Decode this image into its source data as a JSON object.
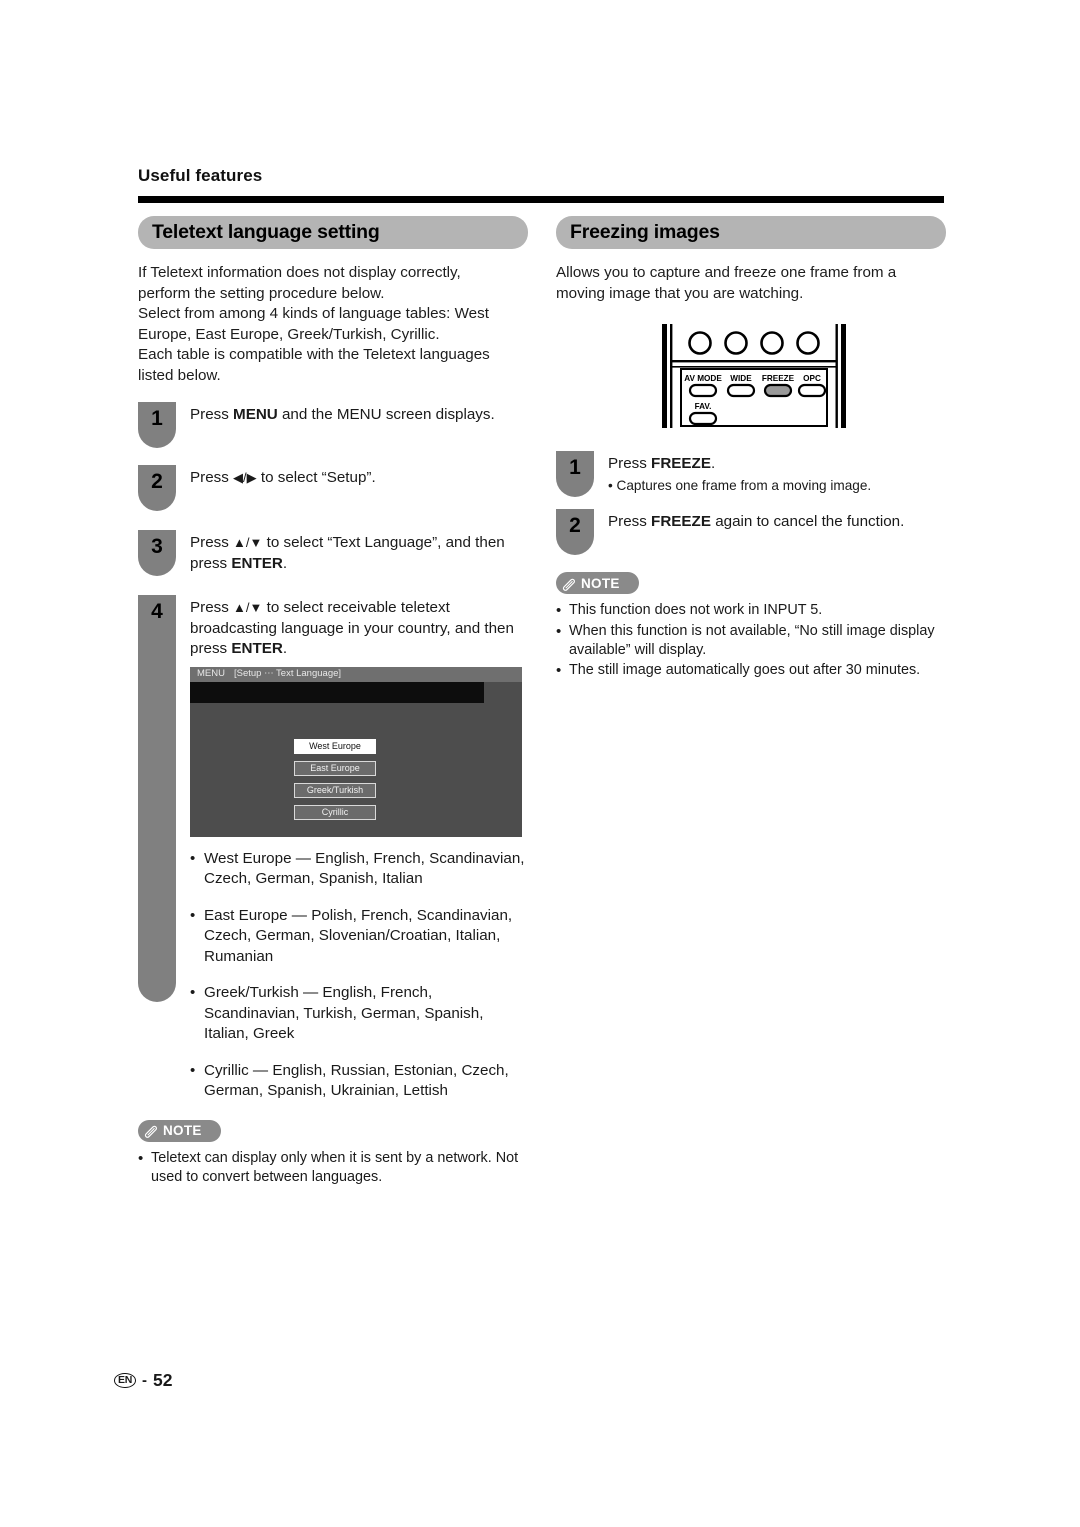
{
  "page": {
    "running_head": "Useful features",
    "footer": {
      "locale_badge": "EN",
      "separator": "-",
      "page_number": "52"
    }
  },
  "left_column": {
    "section_title": "Teletext language setting",
    "intro_lines": [
      "If Teletext information does not display correctly,",
      "perform the setting procedure below.",
      "Select from among 4 kinds of language tables: West",
      "Europe, East Europe, Greek/Turkish, Cyrillic.",
      "Each table is compatible with the Teletext languages",
      "listed below."
    ],
    "steps": [
      {
        "number": "1",
        "text_before": "Press ",
        "bold_1": "MENU",
        "text_after": " and the MENU screen displays."
      },
      {
        "number": "2",
        "text_before": "Press ",
        "glyphs": "◀/▶",
        "text_after": " to select “Setup”."
      },
      {
        "number": "3",
        "text_before": "Press ",
        "glyphs": "▲/▼",
        "text_mid": " to select “Text Language”, and then press ",
        "bold_1": "ENTER",
        "text_after": "."
      },
      {
        "number": "4",
        "text_before": "Press ",
        "glyphs": "▲/▼",
        "text_mid": " to select receivable teletext broadcasting language in your country, and then press ",
        "bold_1": "ENTER",
        "text_after": "."
      }
    ],
    "osd": {
      "bar_menu_label": "MENU",
      "bar_path_label": "[Setup ⋯ Text Language]",
      "options": [
        {
          "label": "West Europe",
          "selected": true
        },
        {
          "label": "East Europe",
          "selected": false
        },
        {
          "label": "Greek/Turkish",
          "selected": false
        },
        {
          "label": "Cyrillic",
          "selected": false
        }
      ]
    },
    "language_bullets": [
      "West Europe — English, French, Scandinavian, Czech, German, Spanish, Italian",
      "East Europe — Polish, French, Scandinavian, Czech, German, Slovenian/Croatian, Italian, Rumanian",
      "Greek/Turkish — English, French, Scandinavian, Turkish, German, Spanish, Italian, Greek",
      "Cyrillic — English, Russian, Estonian, Czech, German, Spanish, Ukrainian, Lettish"
    ],
    "note": {
      "label": "NOTE",
      "items": [
        "Teletext can display only when it is sent by a network. Not used to convert between languages."
      ]
    }
  },
  "right_column": {
    "section_title": "Freezing images",
    "intro_lines": [
      "Allows you to capture and freeze one frame from a",
      "moving image that you are watching."
    ],
    "remote": {
      "button_labels": [
        "AV MODE",
        "WIDE",
        "FREEZE",
        "OPC"
      ],
      "fav_label": "FAV.",
      "highlighted_button": "FREEZE"
    },
    "steps": [
      {
        "number": "1",
        "text_before": "Press ",
        "bold_1": "FREEZE",
        "text_after": ".",
        "substep": "• Captures one frame from a moving image."
      },
      {
        "number": "2",
        "text_before": "Press ",
        "bold_1": "FREEZE",
        "text_after": " again to cancel the function."
      }
    ],
    "note": {
      "label": "NOTE",
      "items": [
        "This function does not work in INPUT 5.",
        "When this function is not available, “No still image display available” will display.",
        "The still image automatically goes out after 30 minutes."
      ]
    }
  },
  "colors": {
    "badge_gray": "#808080",
    "pill_gray": "#b4b4b4",
    "note_gray": "#8a8a8a",
    "osd_screen": "#4d4d4d",
    "osd_bar": "#6f6f6f"
  }
}
